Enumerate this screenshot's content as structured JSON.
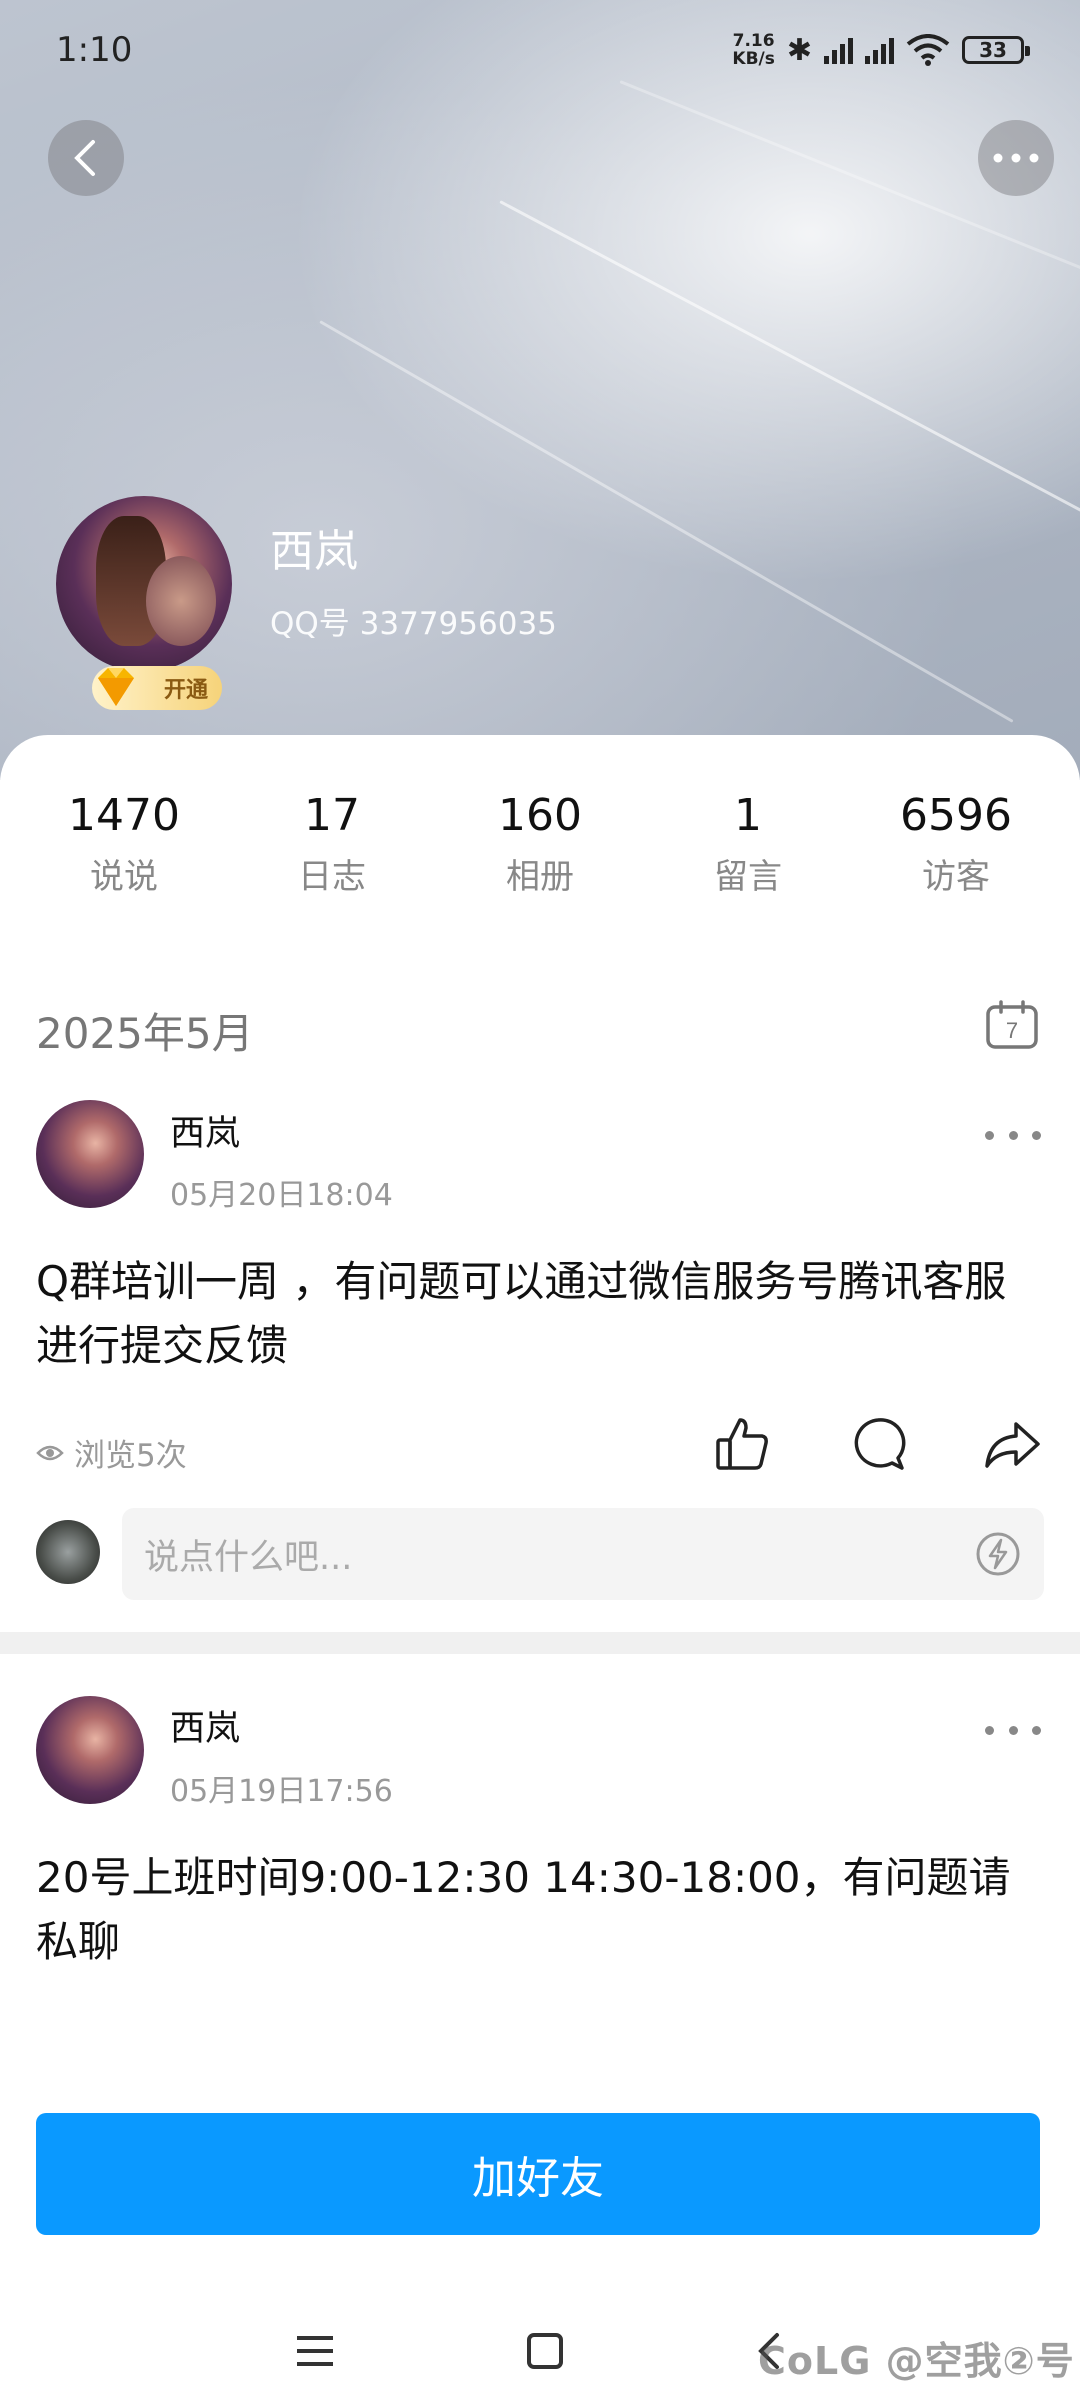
{
  "status_bar": {
    "time": "1:10",
    "net_speed_value": "7.16",
    "net_speed_unit": "KB/s",
    "battery": "33"
  },
  "profile": {
    "name": "西岚",
    "qq_number": "QQ号 3377956035",
    "vip_badge": "开通"
  },
  "stats": [
    {
      "value": "1470",
      "label": "说说"
    },
    {
      "value": "17",
      "label": "日志"
    },
    {
      "value": "160",
      "label": "相册"
    },
    {
      "value": "1",
      "label": "留言"
    },
    {
      "value": "6596",
      "label": "访客"
    }
  ],
  "feed": {
    "month_header": "2025年5月",
    "calendar_day": "7",
    "comment_placeholder": "说点什么吧...",
    "posts": [
      {
        "author": "西岚",
        "time": "05月20日18:04",
        "text": " Q群培训一周 ，有问题可以通过微信服务号腾讯客服进行提交反馈",
        "views": "浏览5次"
      },
      {
        "author": "西岚",
        "time": "05月19日17:56",
        "text": "20号上班时间9:00-12:30 14:30-18:00，有问题请私聊"
      }
    ]
  },
  "actions": {
    "add_friend": "加好友"
  },
  "watermark": "CoLG @空我②号",
  "colors": {
    "accent": "#0a99ff",
    "muted_text": "#999999"
  }
}
